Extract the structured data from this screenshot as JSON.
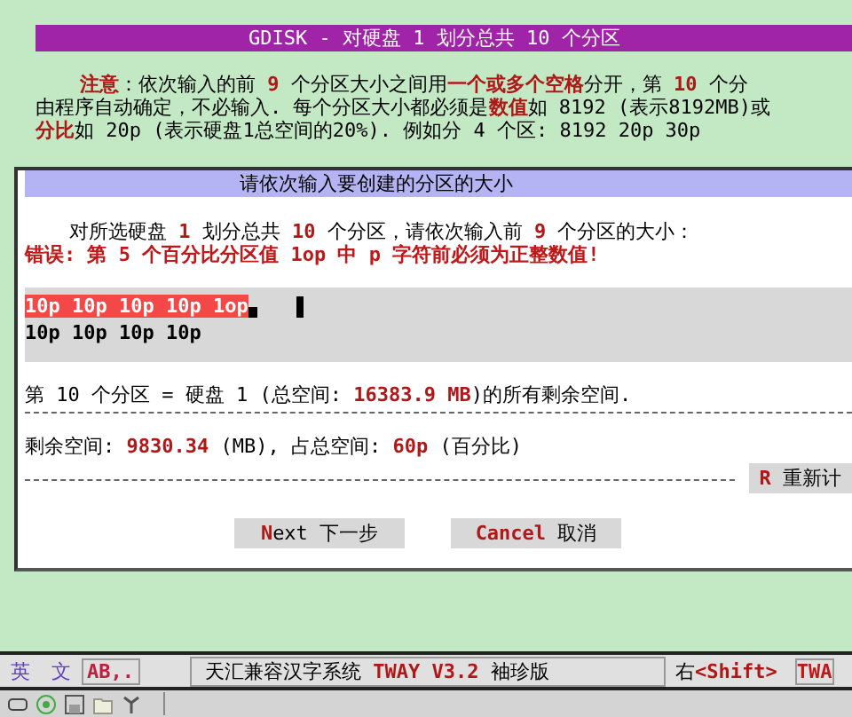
{
  "title_bar": {
    "title": "GDISK - 对硬盘 1 划分总共 10 个分区"
  },
  "notice_lines": [
    [
      {
        "text": "注意",
        "emphasis": true
      },
      {
        "text": "：依次输入的前 ",
        "emphasis": false
      },
      {
        "text": "9",
        "emphasis": true
      },
      {
        "text": " 个分区大小之间用",
        "emphasis": false
      },
      {
        "text": "一个或多个空格",
        "emphasis": true
      },
      {
        "text": "分开，第 ",
        "emphasis": false
      },
      {
        "text": "10",
        "emphasis": true
      },
      {
        "text": " 个分",
        "emphasis": false
      }
    ],
    [
      {
        "text": "由程序自动确定，不必输入. 每个分区大小都必须是",
        "emphasis": false
      },
      {
        "text": "数值",
        "emphasis": true
      },
      {
        "text": "如 8192 (表示8192MB)或",
        "emphasis": false
      }
    ],
    [
      {
        "text": "分比",
        "emphasis": true
      },
      {
        "text": "如 20p (表示硬盘1总空间的20%). 例如分 4 个区: 8192 20p   30p",
        "emphasis": false
      }
    ]
  ],
  "dialog": {
    "title": "请依次输入要创建的分区的大小",
    "prompt": [
      {
        "text": "对所选硬盘 ",
        "emphasis": false
      },
      {
        "text": "1",
        "emphasis": true
      },
      {
        "text": " 划分总共 ",
        "emphasis": false
      },
      {
        "text": "10",
        "emphasis": true
      },
      {
        "text": " 个分区，请依次输入前 ",
        "emphasis": false
      },
      {
        "text": "9",
        "emphasis": true
      },
      {
        "text": " 个分区的大小：",
        "emphasis": false
      }
    ],
    "error": "错误: 第 5 个百分比分区值 1op 中 p 字符前必须为正整数值!",
    "input": {
      "lines": [
        {
          "text": "10p 10p 10p 10p 1op",
          "selected": true
        },
        {
          "text": "10p 10p 10p 10p",
          "selected": false
        }
      ]
    },
    "last_partition": [
      {
        "text": "第 10 个分区 = 硬盘 1 (总空间: ",
        "emphasis": false
      },
      {
        "text": "16383.9 MB",
        "emphasis": true
      },
      {
        "text": ")的所有剩余空间.",
        "emphasis": false
      }
    ],
    "remaining": [
      {
        "text": "剩余空间: ",
        "emphasis": false
      },
      {
        "text": "9830.34",
        "emphasis": true
      },
      {
        "text": " (MB), 占总空间: ",
        "emphasis": false
      },
      {
        "text": "60p",
        "emphasis": true
      },
      {
        "text": " (百分比)",
        "emphasis": false
      }
    ],
    "recalc_button": [
      {
        "text": "R",
        "emphasis": true
      },
      {
        "text": " 重新计",
        "emphasis": false
      }
    ],
    "buttons": [
      [
        {
          "text": "N",
          "emphasis": true
        },
        {
          "text": "ext 下一步",
          "emphasis": false
        }
      ],
      [
        {
          "text": "Cancel",
          "emphasis": true
        },
        {
          "text": " 取消",
          "emphasis": false
        }
      ]
    ]
  },
  "status_bar": {
    "input_mode": [
      "英",
      "文"
    ],
    "punct_mode": "AB,.",
    "system": [
      {
        "text": "天汇兼容汉字系统 ",
        "emphasis": false
      },
      {
        "text": "TWAY V3.2",
        "emphasis": true
      },
      {
        "text": " 袖珍版",
        "emphasis": false
      }
    ],
    "shift_hint": [
      {
        "text": "右",
        "emphasis": false
      },
      {
        "text": "<Shift>",
        "emphasis": true
      }
    ],
    "right_label": "TWA"
  }
}
